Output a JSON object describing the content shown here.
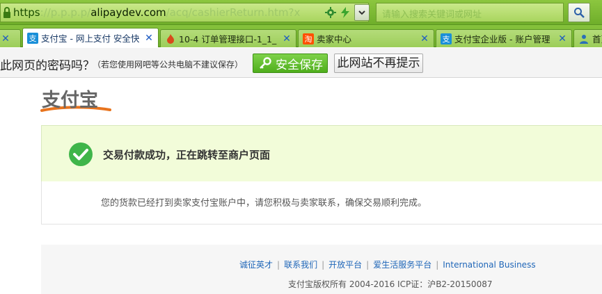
{
  "address_bar": {
    "scheme": "https",
    "faded_left": "://p.p.p.p/",
    "host": "alipaydev.com",
    "faded_right": "/acq/cashierReturn.htm?x",
    "search_placeholder": "请输入搜索关键词或网址"
  },
  "tabs": [
    {
      "title": "",
      "icon": "tab-favicon",
      "active": false
    },
    {
      "title": "支付宝 - 网上支付 安全快",
      "icon": "alipay-icon",
      "active": true
    },
    {
      "title": "10-4 订单管理接口-1_1_",
      "icon": "flame-icon",
      "active": false
    },
    {
      "title": "卖家中心",
      "icon": "taobao-icon",
      "icon_text": "淘",
      "active": false
    },
    {
      "title": "支付宝企业版 - 账户管理",
      "icon": "alipay-icon",
      "active": false
    },
    {
      "title": "首页",
      "icon": "person-icon",
      "active": false
    }
  ],
  "password_bar": {
    "question": "此网页的密码吗？",
    "note": "（若您使用网吧等公共电脑不建议保存）",
    "save_label": "安全保存",
    "never_label": "此网站不再提示"
  },
  "logo": {
    "text": "支付宝"
  },
  "result": {
    "title": "交易付款成功，正在跳转至商户页面",
    "detail": "您的货款已经打到卖家支付宝账户中，请您积极与卖家联系，确保交易顺利完成。"
  },
  "footer": {
    "links": [
      "诚征英才",
      "联系我们",
      "开放平台",
      "爱生活服务平台",
      "International Business"
    ],
    "copyright": "支付宝版权所有 2004-2016 ICP证：沪B2-20150087"
  },
  "colors": {
    "browser_green": "#7ab834",
    "success_green": "#3fb54a",
    "link_blue": "#1f66b8",
    "alipay_orange": "#e8741e"
  }
}
